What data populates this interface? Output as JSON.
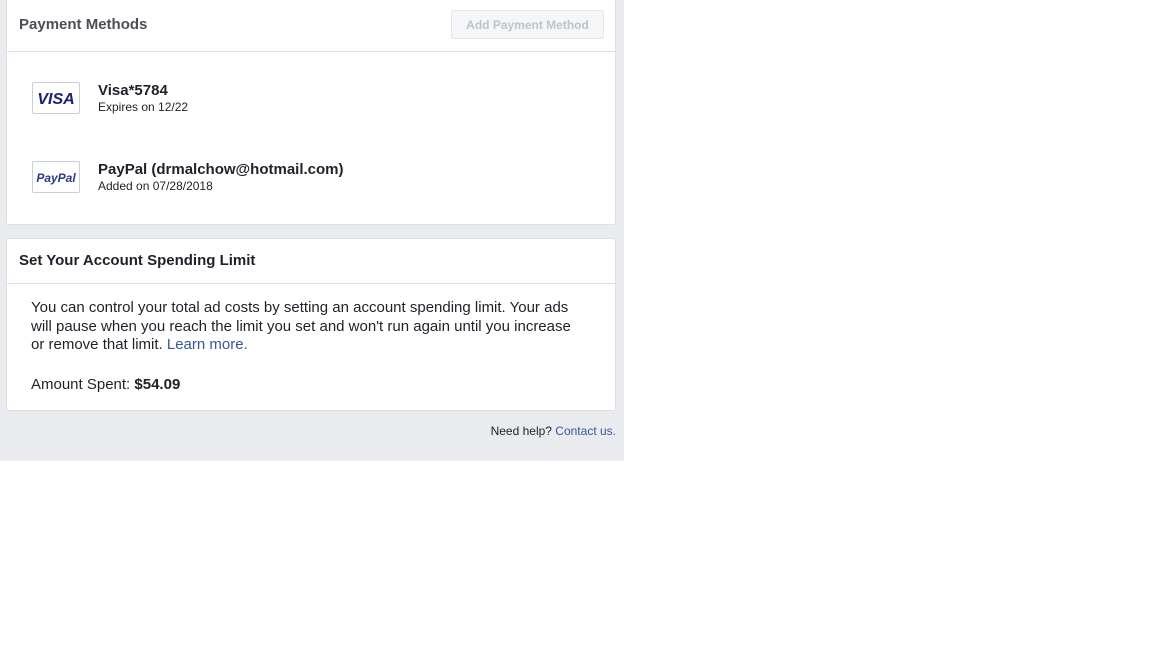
{
  "payment_methods": {
    "title": "Payment Methods",
    "add_button_label": "Add Payment Method",
    "items": [
      {
        "type": "visa",
        "logo_text": "VISA",
        "name": "Visa*5784",
        "detail": "Expires on 12/22"
      },
      {
        "type": "paypal",
        "logo_text": "PayPal",
        "name": "PayPal (drmalchow@hotmail.com)",
        "detail": "Added on 07/28/2018"
      }
    ]
  },
  "spending_limit": {
    "title": "Set Your Account Spending Limit",
    "description": "You can control your total ad costs by setting an account spending limit. Your ads will pause when you reach the limit you set and won't run again until you increase or remove that limit.",
    "learn_more": "Learn more.",
    "amount_label": "Amount Spent:",
    "amount_value": "$54.09"
  },
  "footer": {
    "help_text": "Need help?",
    "contact_link": "Contact us."
  },
  "colors": {
    "page_background": "#e9ebee",
    "link": "#365899",
    "visa_blue": "#1a1f71",
    "paypal_dark": "#253b80",
    "paypal_light": "#179bd7"
  }
}
